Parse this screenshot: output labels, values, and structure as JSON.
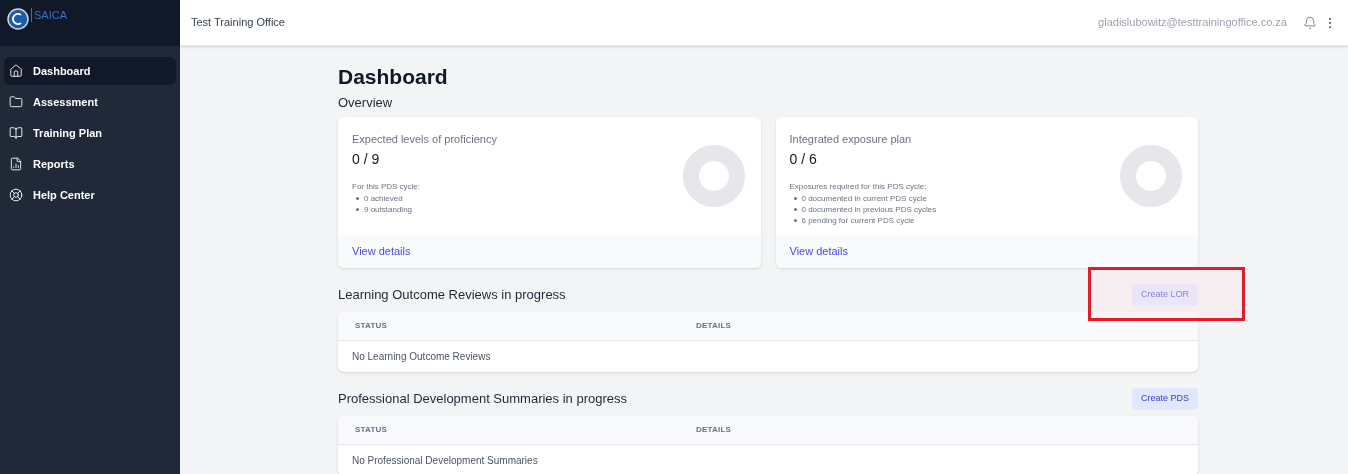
{
  "logo": {
    "text": "SAICA"
  },
  "sidebar": {
    "items": [
      {
        "label": "Dashboard",
        "selected": true
      },
      {
        "label": "Assessment",
        "selected": false
      },
      {
        "label": "Training Plan",
        "selected": false
      },
      {
        "label": "Reports",
        "selected": false
      },
      {
        "label": "Help Center",
        "selected": false
      }
    ]
  },
  "topbar": {
    "office": "Test Training Office",
    "email": "gladislubowitz@testtrainingoffice.co.za"
  },
  "page": {
    "title": "Dashboard",
    "subtitle": "Overview"
  },
  "cards": [
    {
      "title": "Expected levels of proficiency",
      "value": "0 / 9",
      "intro": "For this PDS cycle:",
      "bullets": [
        "0 achieved",
        "9 outstanding"
      ],
      "link": "View details"
    },
    {
      "title": "Integrated exposure plan",
      "value": "0 / 6",
      "intro": "Exposures required for this PDS cycle:",
      "bullets": [
        "0 documented in current PDS cycle",
        "0 documented in previous PDS cycles",
        "6 pending for current PDS cycle"
      ],
      "link": "View details"
    }
  ],
  "sections": [
    {
      "title": "Learning Outcome Reviews in progress",
      "button": "Create LOR",
      "highlighted": true,
      "columns": [
        "STATUS",
        "DETAILS"
      ],
      "empty": "No Learning Outcome Reviews"
    },
    {
      "title": "Professional Development Summaries in progress",
      "button": "Create PDS",
      "highlighted": false,
      "columns": [
        "STATUS",
        "DETAILS"
      ],
      "empty": "No Professional Development Summaries"
    }
  ]
}
